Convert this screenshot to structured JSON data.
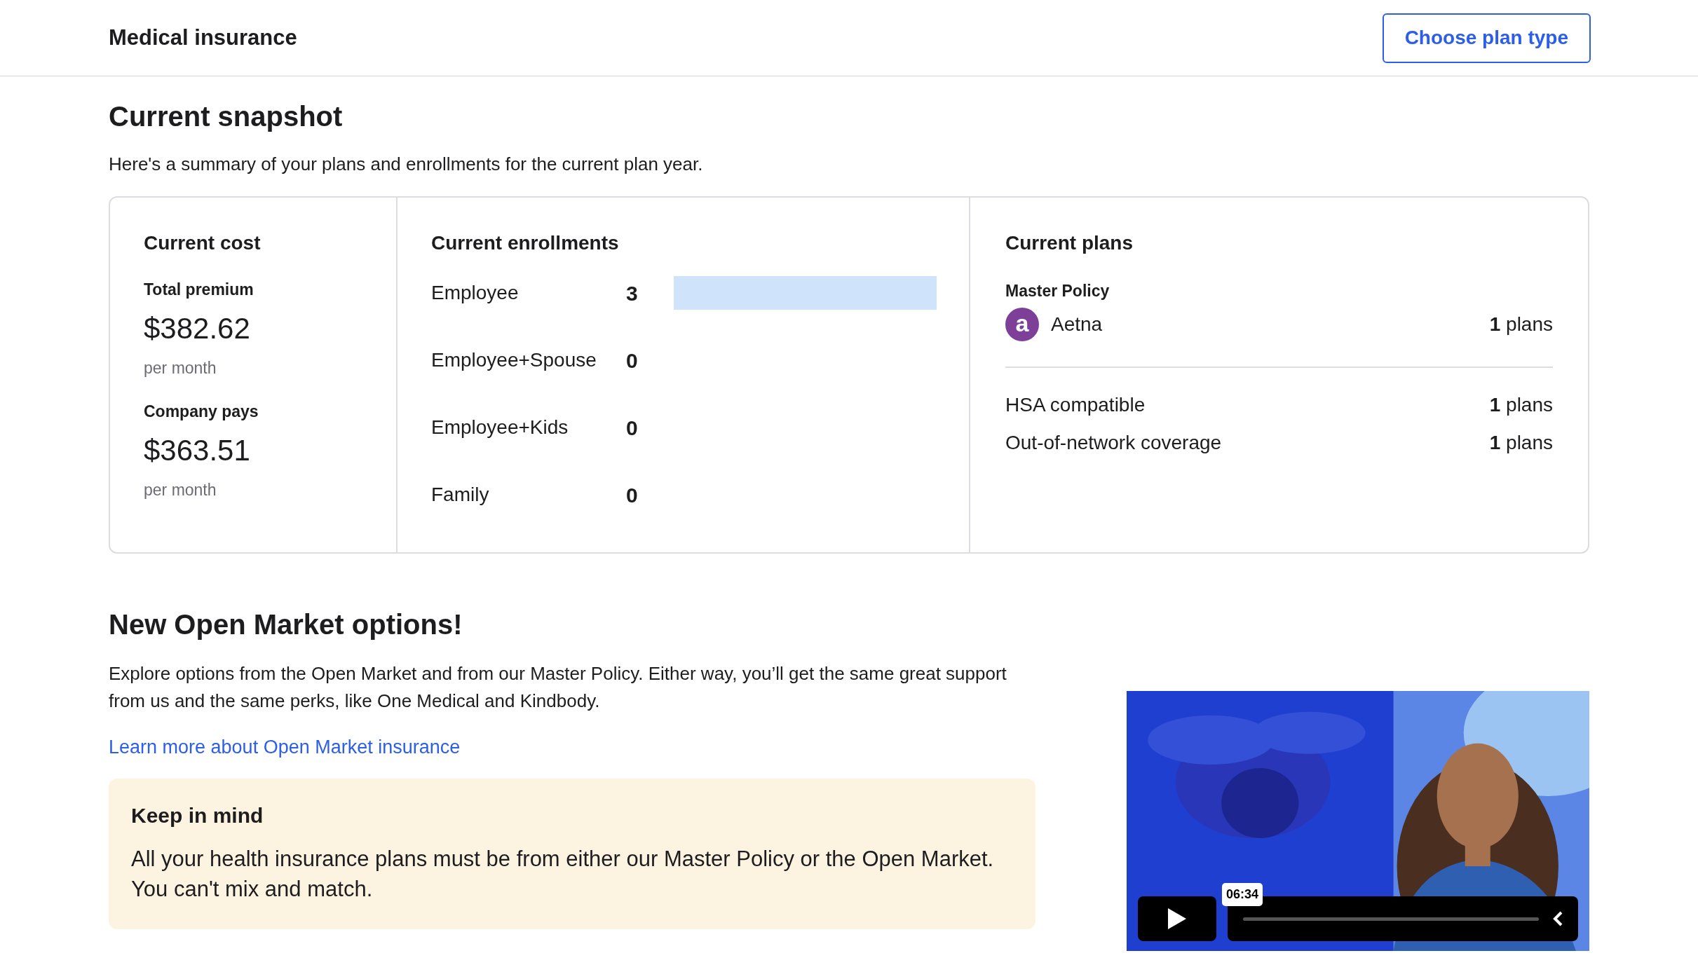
{
  "header": {
    "title": "Medical insurance",
    "button": "Choose plan type"
  },
  "snapshot": {
    "title": "Current snapshot",
    "subtitle": "Here's a summary of your plans and enrollments for the current plan year.",
    "cost": {
      "title": "Current cost",
      "items": [
        {
          "label": "Total premium",
          "amount": "$382.62",
          "period": "per month"
        },
        {
          "label": "Company pays",
          "amount": "$363.51",
          "period": "per month"
        }
      ]
    },
    "enrollments": {
      "title": "Current enrollments",
      "rows": [
        {
          "label": "Employee",
          "count": "3"
        },
        {
          "label": "Employee+Spouse",
          "count": "0"
        },
        {
          "label": "Employee+Kids",
          "count": "0"
        },
        {
          "label": "Family",
          "count": "0"
        }
      ]
    },
    "plans": {
      "title": "Current plans",
      "group": "Master Policy",
      "carrier": {
        "logo": "a",
        "name": "Aetna",
        "count": "**1** plans"
      },
      "features": [
        {
          "label": "HSA compatible",
          "count": "**1** plans"
        },
        {
          "label": "Out-of-network coverage",
          "count": "**1** plans"
        }
      ]
    }
  },
  "open_market": {
    "title": "New Open Market options!",
    "body": "Explore options from the Open Market and from our Master Policy. Either way, you’ll get the same great support from us and the same perks, like One Medical and Kindbody.",
    "link": "Learn more about Open Market insurance",
    "notice": {
      "title": "Keep in mind",
      "body": "All your health insurance plans must be from either our Master Policy or the Open Market. You can't mix and match."
    },
    "video": {
      "kind": "picture",
      "duration": "06:34"
    }
  }
}
